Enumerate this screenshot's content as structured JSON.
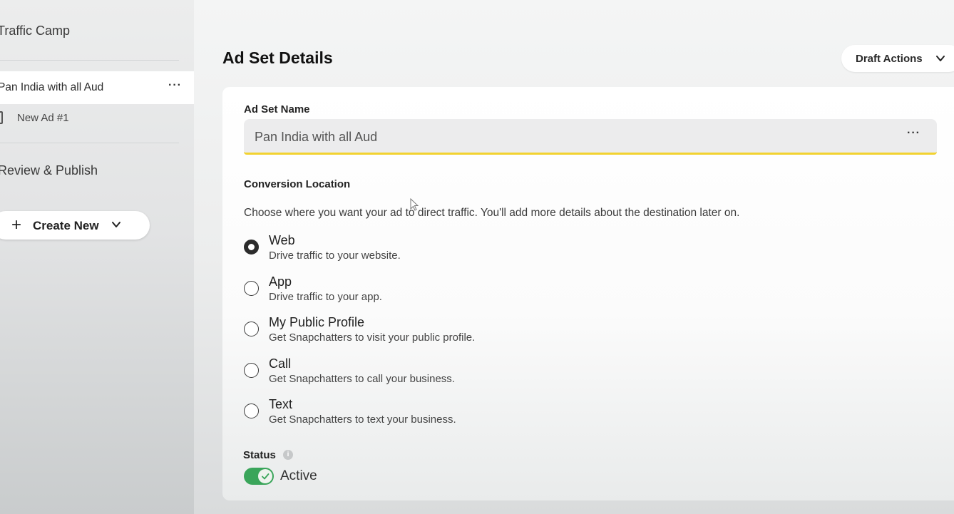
{
  "sidebar": {
    "campaign_label": "Traffic Camp",
    "ad_set_label": "Pan India with all Aud",
    "ad_set_more": "···",
    "ad_label": "New Ad #1",
    "review_label": "Review & Publish",
    "create_new_label": "Create New",
    "create_new_plus": "+"
  },
  "header": {
    "title": "Ad Set Details",
    "draft_actions_label": "Draft Actions"
  },
  "form": {
    "ad_set_name_label": "Ad Set Name",
    "ad_set_name_value": "Pan India with all Aud",
    "ad_set_name_more": "···",
    "conversion_location_label": "Conversion Location",
    "conversion_location_desc": "Choose where you want your ad to direct traffic. You'll add more details about the destination later on.",
    "options": [
      {
        "title": "Web",
        "subtitle": "Drive traffic to your website.",
        "selected": true
      },
      {
        "title": "App",
        "subtitle": "Drive traffic to your app.",
        "selected": false
      },
      {
        "title": "My Public Profile",
        "subtitle": "Get Snapchatters to visit your public profile.",
        "selected": false
      },
      {
        "title": "Call",
        "subtitle": "Get Snapchatters to call your business.",
        "selected": false
      },
      {
        "title": "Text",
        "subtitle": "Get Snapchatters to text your business.",
        "selected": false
      }
    ],
    "status_label": "Status",
    "status_info": "i",
    "status_value": "Active",
    "status_on": true
  },
  "colors": {
    "accent_underline": "#f2d230",
    "toggle_on": "#3aa55a"
  }
}
